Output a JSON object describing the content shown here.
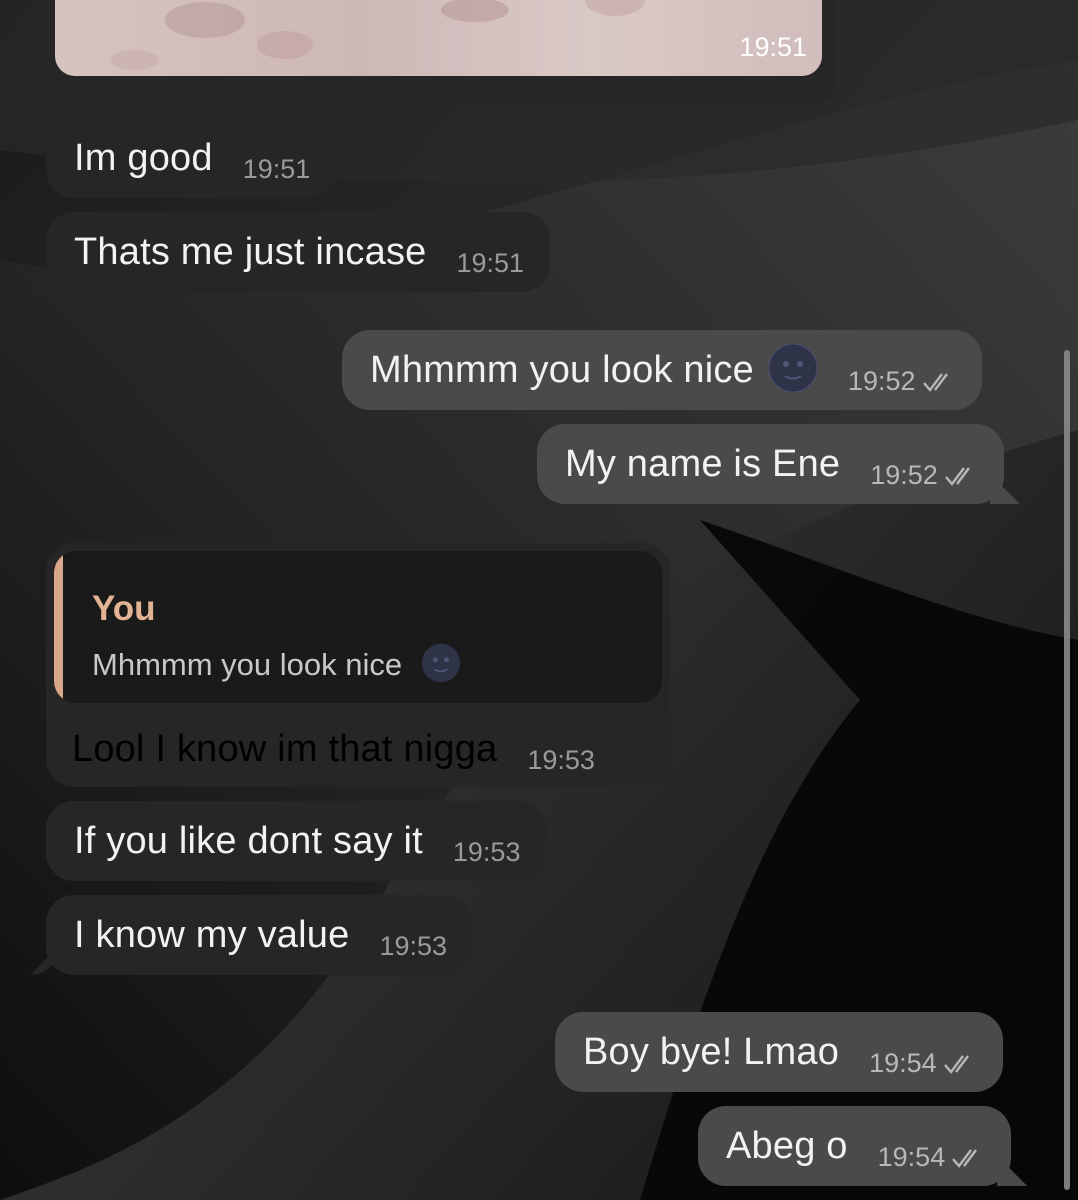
{
  "chat": {
    "photo_message": {
      "time": "19:51"
    },
    "messages": [
      {
        "id": "m1",
        "direction": "incoming",
        "text": "Im good",
        "time": "19:51"
      },
      {
        "id": "m2",
        "direction": "incoming",
        "text": "Thats me just incase",
        "time": "19:51"
      },
      {
        "id": "m3",
        "direction": "outgoing",
        "text": "Mhmmm you look nice",
        "emoji": "new-moon-face",
        "time": "19:52",
        "status": "read"
      },
      {
        "id": "m4",
        "direction": "outgoing",
        "text": "My name is Ene",
        "time": "19:52",
        "status": "read"
      },
      {
        "id": "m5",
        "direction": "incoming",
        "reply_to": {
          "author": "You",
          "text": "Mhmmm you look nice",
          "emoji": "new-moon-face"
        },
        "text": "Lool I know im that nigga",
        "time": "19:53"
      },
      {
        "id": "m6",
        "direction": "incoming",
        "text": "If you like dont say it",
        "time": "19:53"
      },
      {
        "id": "m7",
        "direction": "incoming",
        "text": "I know my value",
        "time": "19:53"
      },
      {
        "id": "m8",
        "direction": "outgoing",
        "text": "Boy bye! Lmao",
        "time": "19:54",
        "status": "read"
      },
      {
        "id": "m9",
        "direction": "outgoing",
        "text": "Abeg o",
        "time": "19:54",
        "status": "read"
      }
    ]
  },
  "colors": {
    "incoming_bubble": "#262626",
    "outgoing_bubble": "#4a4a4a",
    "reply_accent": "#d9a78a",
    "background": "#0b0b0b"
  },
  "icons": {
    "read_status": "double-check-icon",
    "emoji": "new-moon-face-emoji"
  }
}
